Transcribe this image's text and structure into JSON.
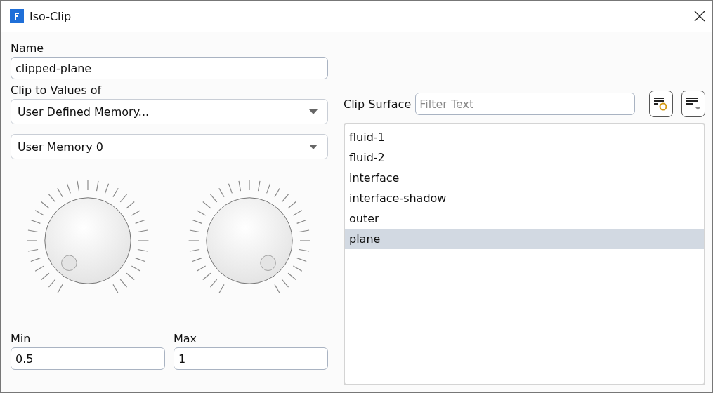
{
  "window": {
    "title": "Iso-Clip"
  },
  "name_field": {
    "label": "Name",
    "value": "clipped-plane"
  },
  "clip_to": {
    "label": "Clip to Values of",
    "dropdowns": [
      "User Defined Memory...",
      "User Memory 0"
    ]
  },
  "range": [
    {
      "label": "Min",
      "value": "0.5"
    },
    {
      "label": "Max",
      "value": "1"
    }
  ],
  "clip_surface": {
    "label": "Clip Surface",
    "filter": {
      "placeholder": "Filter Text"
    },
    "items": [
      {
        "label": "fluid-1",
        "selected": false
      },
      {
        "label": "fluid-2",
        "selected": false
      },
      {
        "label": "interface",
        "selected": false
      },
      {
        "label": "interface-shadow",
        "selected": false
      },
      {
        "label": "outer",
        "selected": false
      },
      {
        "label": "plane",
        "selected": true
      }
    ]
  }
}
